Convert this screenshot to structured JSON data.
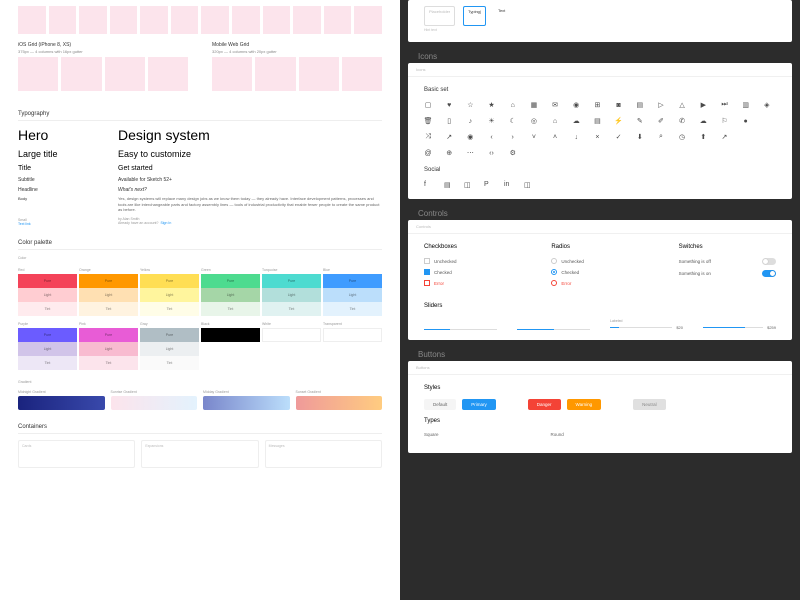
{
  "grids": {
    "ios": {
      "label": "iOS Grid (iPhone 8, XS)",
      "sub": "375px — 4 columns with 16px gutter"
    },
    "mobile": {
      "label": "Mobile Web Grid",
      "sub": "320px — 4 columns with 20px gutter"
    }
  },
  "typography": {
    "heading": "Typography",
    "hero_left": "Hero",
    "hero_right": "Design system",
    "large_left": "Large title",
    "large_right": "Easy to customize",
    "title_left": "Title",
    "title_right": "Get started",
    "subtitle_left": "Subtitle",
    "subtitle_right": "Available for Sketch 52+",
    "headline_left": "Headline",
    "headline_right": "What's next?",
    "body_left": "Body",
    "body_right": "Yes, design systems will replace many design jobs as we know them today — they already have. Interface development patterns, processes and tools are like interchangeable parts and factory assembly lines — tools of industrial productivity that enable fewer people to create the same product as before.",
    "small_left": "Small",
    "small_right": "by Alan Smith",
    "link_left": "Text link",
    "account": "Already have an account?",
    "signin": "Sign In"
  },
  "palette": {
    "heading": "Color palette",
    "color_heading": "Color",
    "row1": [
      {
        "name": "Red",
        "pure": "#f44359",
        "light": "#ffcdd2",
        "tint": "#ffebee"
      },
      {
        "name": "Orange",
        "pure": "#ff9800",
        "light": "#ffe0b2",
        "tint": "#fff3e0"
      },
      {
        "name": "Yellow",
        "pure": "#ffde54",
        "light": "#fff59d",
        "tint": "#fffde7"
      },
      {
        "name": "Green",
        "pure": "#4ddb8f",
        "light": "#a5d6a7",
        "tint": "#e8f5e9"
      },
      {
        "name": "Turquoise",
        "pure": "#4ddbd0",
        "light": "#b2dfdb",
        "tint": "#e0f2f1"
      },
      {
        "name": "Blue",
        "pure": "#3f9cff",
        "light": "#bbdefb",
        "tint": "#e3f2fd"
      }
    ],
    "row2": [
      {
        "name": "Purple",
        "pure": "#6b5cff",
        "light": "#d1c4e9",
        "tint": "#ede7f6"
      },
      {
        "name": "Pink",
        "pure": "#e85cd6",
        "light": "#f8bbd0",
        "tint": "#fce4ec"
      },
      {
        "name": "Gray",
        "pure": "#b0bec5",
        "light": "#eceff1",
        "tint": "#fafafa"
      },
      {
        "name": "Black",
        "pure": "#000000",
        "light": "",
        "tint": ""
      },
      {
        "name": "White",
        "pure": "",
        "light": "",
        "tint": ""
      },
      {
        "name": "Transparent",
        "pure": "",
        "light": "",
        "tint": ""
      }
    ],
    "pure_label": "Pure",
    "light_label": "Light",
    "tint_label": "Tint",
    "gradient_heading": "Gradient",
    "gradients": [
      {
        "name": "Midnight Gradient",
        "from": "#1a237e",
        "to": "#3949ab"
      },
      {
        "name": "Sunrise Gradient",
        "from": "#fce4ec",
        "to": "#e3f2fd"
      },
      {
        "name": "Midday Gradient",
        "from": "#7986cb",
        "to": "#bbdefb"
      },
      {
        "name": "Sunset Gradient",
        "from": "#ef9a9a",
        "to": "#ffcc80"
      }
    ]
  },
  "containers": {
    "heading": "Containers",
    "items": [
      "Cards",
      "Expansions",
      "Messages"
    ]
  },
  "inputs": {
    "placeholder": "Placeholder",
    "typing": "Typing|",
    "text": "Text",
    "hint": "Hint text"
  },
  "icons": {
    "heading": "Icons",
    "breadcrumb": "Icons",
    "basic_title": "Basic set",
    "social_title": "Social",
    "names": [
      "bookmark-outline-icon",
      "heart-icon",
      "star-outline-icon",
      "star-icon",
      "tag-icon",
      "calendar-icon",
      "bell-icon",
      "user-icon",
      "users-icon",
      "camera-icon",
      "cart-icon",
      "play-box-icon",
      "triangle-icon",
      "play-icon",
      "skip-icon",
      "film-icon",
      "video-icon",
      "trash-icon",
      "file-icon",
      "note-icon",
      "sun-icon",
      "moon-icon",
      "target-icon",
      "home-icon",
      "cloud-icon",
      "chart-icon",
      "lightning-icon",
      "pencil-icon",
      "pen-icon",
      "phone-icon",
      "cloud-upload-icon",
      "award-icon",
      "mic-icon",
      "null-icon",
      "shuffle-icon",
      "share-icon",
      "eye-icon",
      "chevron-left-icon",
      "chevron-right-icon",
      "chevron-down-icon",
      "chevron-up-icon",
      "arrow-down-icon",
      "close-icon",
      "check-icon",
      "download-icon",
      "search-icon",
      "clock-icon",
      "upload-icon",
      "external-icon",
      "null2-icon",
      "null3-icon",
      "at-icon",
      "globe-icon",
      "dots-icon",
      "code-icon",
      "gear-icon"
    ],
    "glyphs": [
      "▢",
      "♥",
      "☆",
      "★",
      "⌂",
      "▦",
      "✉",
      "◉",
      "⊞",
      "◙",
      "▤",
      "▷",
      "△",
      "▶",
      "⏭",
      "▥",
      "◈",
      "🗑",
      "▯",
      "♪",
      "☀",
      "☾",
      "◎",
      "⌂",
      "☁",
      "▤",
      "⚡",
      "✎",
      "✐",
      "✆",
      "☁",
      "⚐",
      "●",
      "",
      "⤨",
      "↗",
      "◉",
      "‹",
      "›",
      "˅",
      "˄",
      "↓",
      "×",
      "✓",
      "⬇",
      "⌕",
      "◷",
      "⬆",
      "↗",
      "",
      "",
      "@",
      "⊕",
      "⋯",
      "‹›",
      "⚙"
    ],
    "social_names": [
      "facebook-icon",
      "twitter-icon",
      "instagram-icon",
      "pinterest-icon",
      "linkedin-icon",
      "share-social-icon"
    ],
    "social_glyphs": [
      "f",
      "▤",
      "◫",
      "P",
      "in",
      "◫"
    ]
  },
  "controls": {
    "heading": "Controls",
    "breadcrumb": "Controls",
    "checkboxes_title": "Checkboxes",
    "radios_title": "Radios",
    "switches_title": "Switches",
    "unchecked": "Unchecked",
    "checked": "Checked",
    "error": "Error",
    "switch_off": "Something is off",
    "switch_on": "Something is on",
    "sliders_title": "Sliders",
    "labeled": "Labeled",
    "val20": "$20",
    "val259": "$259"
  },
  "buttons": {
    "heading": "Buttons",
    "breadcrumb": "Buttons",
    "styles_title": "Styles",
    "types_title": "Types",
    "default": "Default",
    "primary": "Primary",
    "danger": "Danger",
    "warning": "Warning",
    "neutral": "Neutral",
    "square": "Square",
    "round": "Round"
  }
}
